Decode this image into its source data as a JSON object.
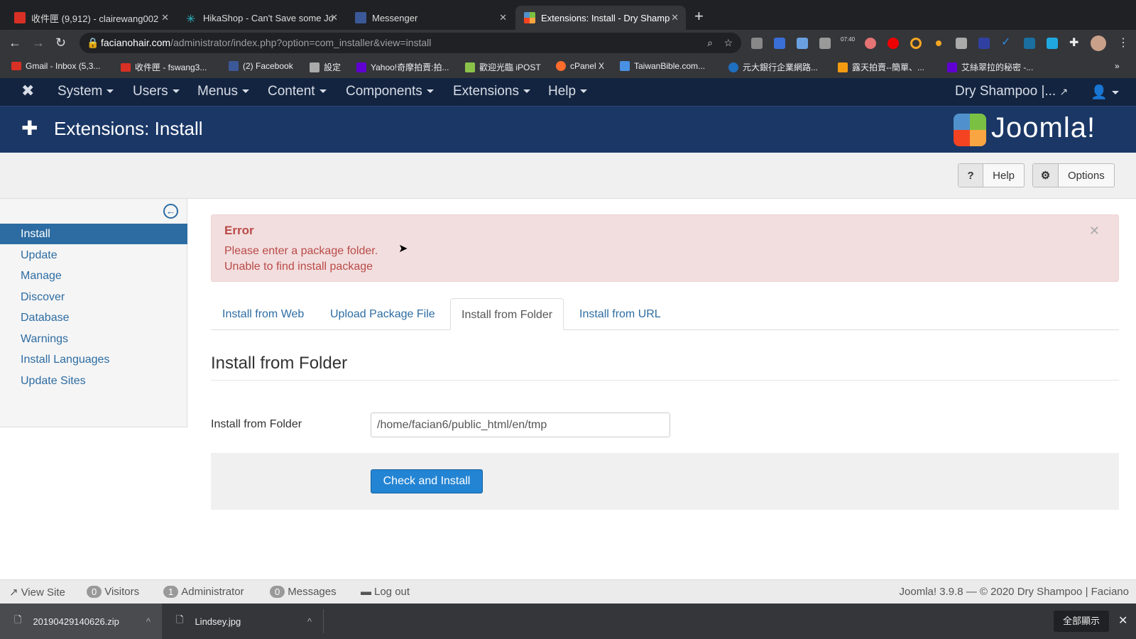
{
  "browser": {
    "tabs": [
      {
        "title": "收件匣 (9,912) - clairewang002",
        "icon": "gmail-icon"
      },
      {
        "title": "HikaShop - Can't Save some Jo",
        "icon": "hikashop-icon"
      },
      {
        "title": "Messenger",
        "icon": "facebook-icon"
      },
      {
        "title": "Extensions: Install - Dry Shamp",
        "icon": "joomla-icon"
      }
    ],
    "url_domain": "facianohair.com",
    "url_path": "/administrator/index.php?option=com_installer&view=install",
    "extension_clock": "07:40",
    "bookmarks": [
      "Gmail - Inbox (5,3...",
      "收件匣 - fswang3...",
      "(2) Facebook",
      "設定",
      "Yahoo!奇摩拍賣:拍...",
      "歡迎光臨 iPOST",
      "cPanel X",
      "TaiwanBible.com...",
      "元大銀行企業網路...",
      "露天拍賣--簡單、...",
      "艾絲翠拉的秘密 -..."
    ]
  },
  "nav": {
    "items": [
      "System",
      "Users",
      "Menus",
      "Content",
      "Components",
      "Extensions",
      "Help"
    ],
    "site": "Dry Shampoo |..."
  },
  "header": {
    "title": "Extensions: Install",
    "logo": "Joomla!"
  },
  "toolbar": {
    "help": "Help",
    "options": "Options"
  },
  "sidebar": {
    "items": [
      "Install",
      "Update",
      "Manage",
      "Discover",
      "Database",
      "Warnings",
      "Install Languages",
      "Update Sites"
    ],
    "active": 0
  },
  "alert": {
    "heading": "Error",
    "messages": [
      "Please enter a package folder.",
      "Unable to find install package"
    ],
    "color": "#b94a48"
  },
  "tabs": [
    "Install from Web",
    "Upload Package File",
    "Install from Folder",
    "Install from URL"
  ],
  "form": {
    "heading": "Install from Folder",
    "label": "Install from Folder",
    "value": "/home/facian6/public_html/en/tmp",
    "button": "Check and Install"
  },
  "status": {
    "view_site": "View Site",
    "visitors_count": "0",
    "visitors": "Visitors",
    "admin_count": "1",
    "admin": "Administrator",
    "messages_count": "0",
    "messages": "Messages",
    "logout": "Log out",
    "version": "Joomla! 3.9.8  —  © 2020 Dry Shampoo | Faciano"
  },
  "downloads": {
    "files": [
      "20190429140626.zip",
      "Lindsey.jpg"
    ],
    "show_all": "全部顯示"
  }
}
